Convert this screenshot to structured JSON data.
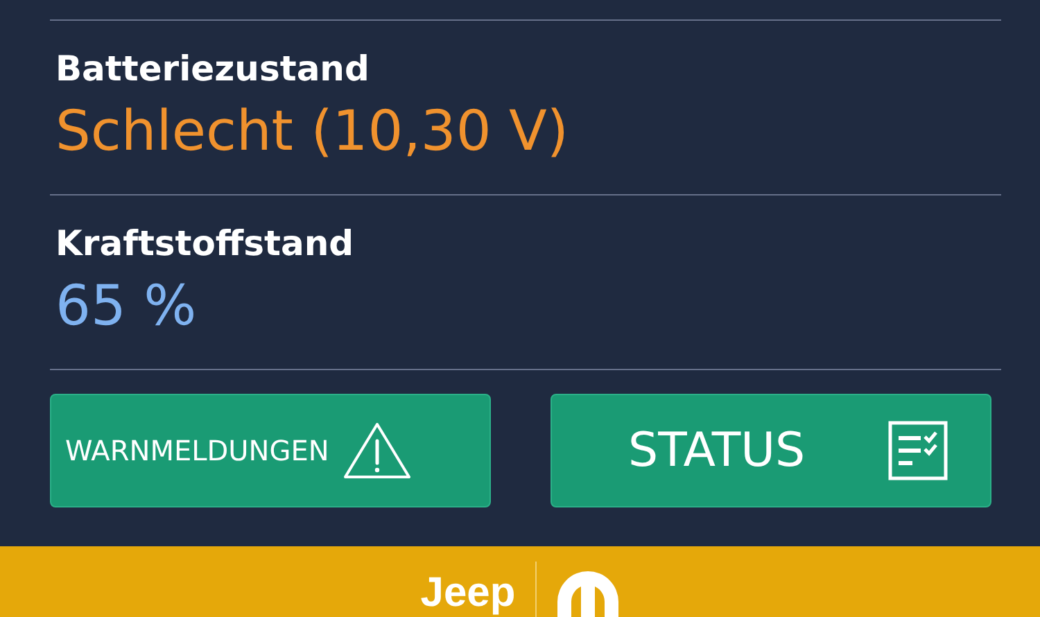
{
  "readings": [
    {
      "label": "Batteriezustand",
      "value": "Schlecht (10,30 V)",
      "color": "#f0922e"
    },
    {
      "label": "Kraftstoffstand",
      "value": "65 %",
      "color": "#7fb2f0"
    }
  ],
  "buttons": [
    {
      "kind": "warning",
      "label": "WARNMELDUNGEN"
    },
    {
      "kind": "status",
      "label": "STATUS"
    }
  ],
  "footer": {
    "brand": "Jeep"
  }
}
